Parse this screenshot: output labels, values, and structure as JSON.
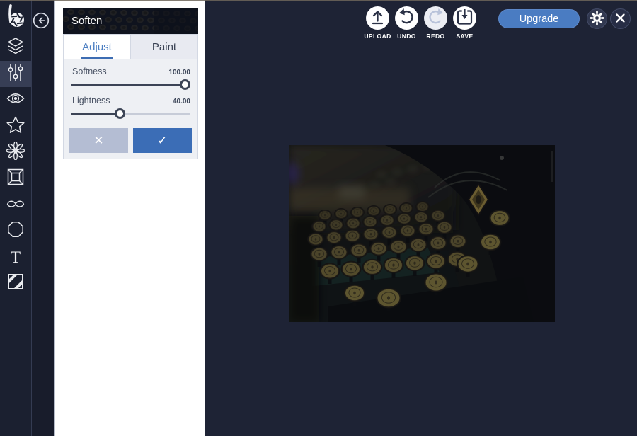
{
  "panel": {
    "title": "Soften",
    "tabs": [
      {
        "label": "Adjust",
        "active": true
      },
      {
        "label": "Paint",
        "active": false
      }
    ],
    "sliders": [
      {
        "label": "Softness",
        "value": "100.00",
        "percent": 100
      },
      {
        "label": "Lightness",
        "value": "40.00",
        "percent": 40
      }
    ],
    "actions": {
      "cancel": "✕",
      "apply": "✓"
    }
  },
  "toolbar": {
    "upload": "UPLOAD",
    "undo": "UNDO",
    "redo": "REDO",
    "save": "SAVE",
    "redo_disabled": true
  },
  "topbar": {
    "upgrade": "Upgrade"
  },
  "sidebar": {
    "selected": "edit-tools",
    "items": [
      "befunky-logo",
      "layers",
      "edit-tools",
      "effects",
      "artsy-effects",
      "touch-up",
      "frames",
      "graphics",
      "overlays",
      "text",
      "textures"
    ]
  },
  "colors": {
    "accent_blue": "#4a7cc2",
    "apply_blue": "#3b6db6",
    "cancel_gray": "#b4bdd3",
    "active_tab_blue": "#4b7ec2",
    "canvas_bg": "#1e2335",
    "sidebar_bg": "#1b2030",
    "sidebar_selected": "#373e55",
    "slider_fill": "#3c4456"
  }
}
